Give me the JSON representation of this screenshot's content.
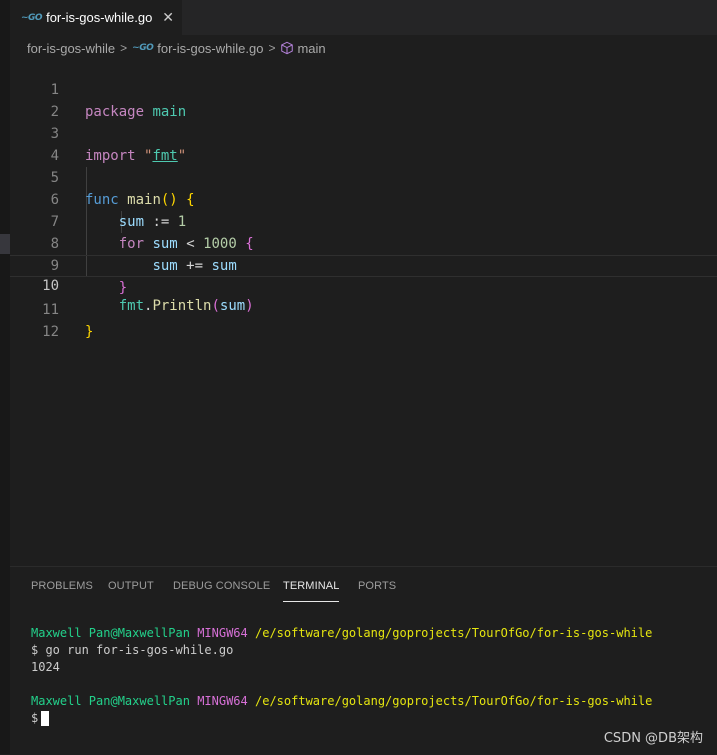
{
  "tab": {
    "icon": "go-file-icon",
    "icon_text": "~GO",
    "label": "for-is-gos-while.go",
    "close": "✕"
  },
  "breadcrumb": {
    "folder": "for-is-gos-while",
    "file": "for-is-gos-while.go",
    "symbol": "main",
    "sep": ">"
  },
  "editor": {
    "line_numbers": [
      "1",
      "2",
      "3",
      "4",
      "5",
      "6",
      "7",
      "8",
      "9",
      "10",
      "11",
      "12"
    ],
    "active_line": "10"
  },
  "code_tokens": {
    "l1_kw": "package",
    "l1_name": "main",
    "l3_kw": "import",
    "l3_q1": "\"",
    "l3_pkg": "fmt",
    "l3_q2": "\"",
    "l5_kw": "func",
    "l5_fn": "main",
    "l5_paren": "()",
    "l5_brace": "{",
    "l6_var": "sum",
    "l6_op": ":=",
    "l6_num": "1",
    "l7_kw": "for",
    "l7_var": "sum",
    "l7_op": "<",
    "l7_num": "1000",
    "l7_brace": "{",
    "l8_var1": "sum",
    "l8_op": "+=",
    "l8_var2": "sum",
    "l9_brace": "}",
    "l10_pkg": "fmt",
    "l10_dot": ".",
    "l10_fn": "Println",
    "l10_p1": "(",
    "l10_arg": "sum",
    "l10_p2": ")",
    "l11_brace": "}"
  },
  "panel": {
    "tabs": [
      "PROBLEMS",
      "OUTPUT",
      "DEBUG CONSOLE",
      "TERMINAL",
      "PORTS"
    ],
    "active_tab": "TERMINAL"
  },
  "terminal": {
    "user": "Maxwell Pan@MaxwellPan",
    "env": "MINGW64",
    "path": "/e/software/golang/goprojects/TourOfGo/for-is-gos-while",
    "command_prompt": "$ go run for-is-gos-while.go",
    "output": "1024",
    "prompt": "$"
  },
  "watermark": "CSDN @DB架构",
  "colors": {
    "accent_keyword": "#569cd6",
    "accent_control": "#c586c0",
    "accent_func": "#dcdcaa",
    "accent_var": "#9cdcfe",
    "accent_type": "#4ec9b0",
    "terminal_green": "#23d18b",
    "terminal_magenta": "#d670d6",
    "terminal_yellow": "#e5e510"
  }
}
